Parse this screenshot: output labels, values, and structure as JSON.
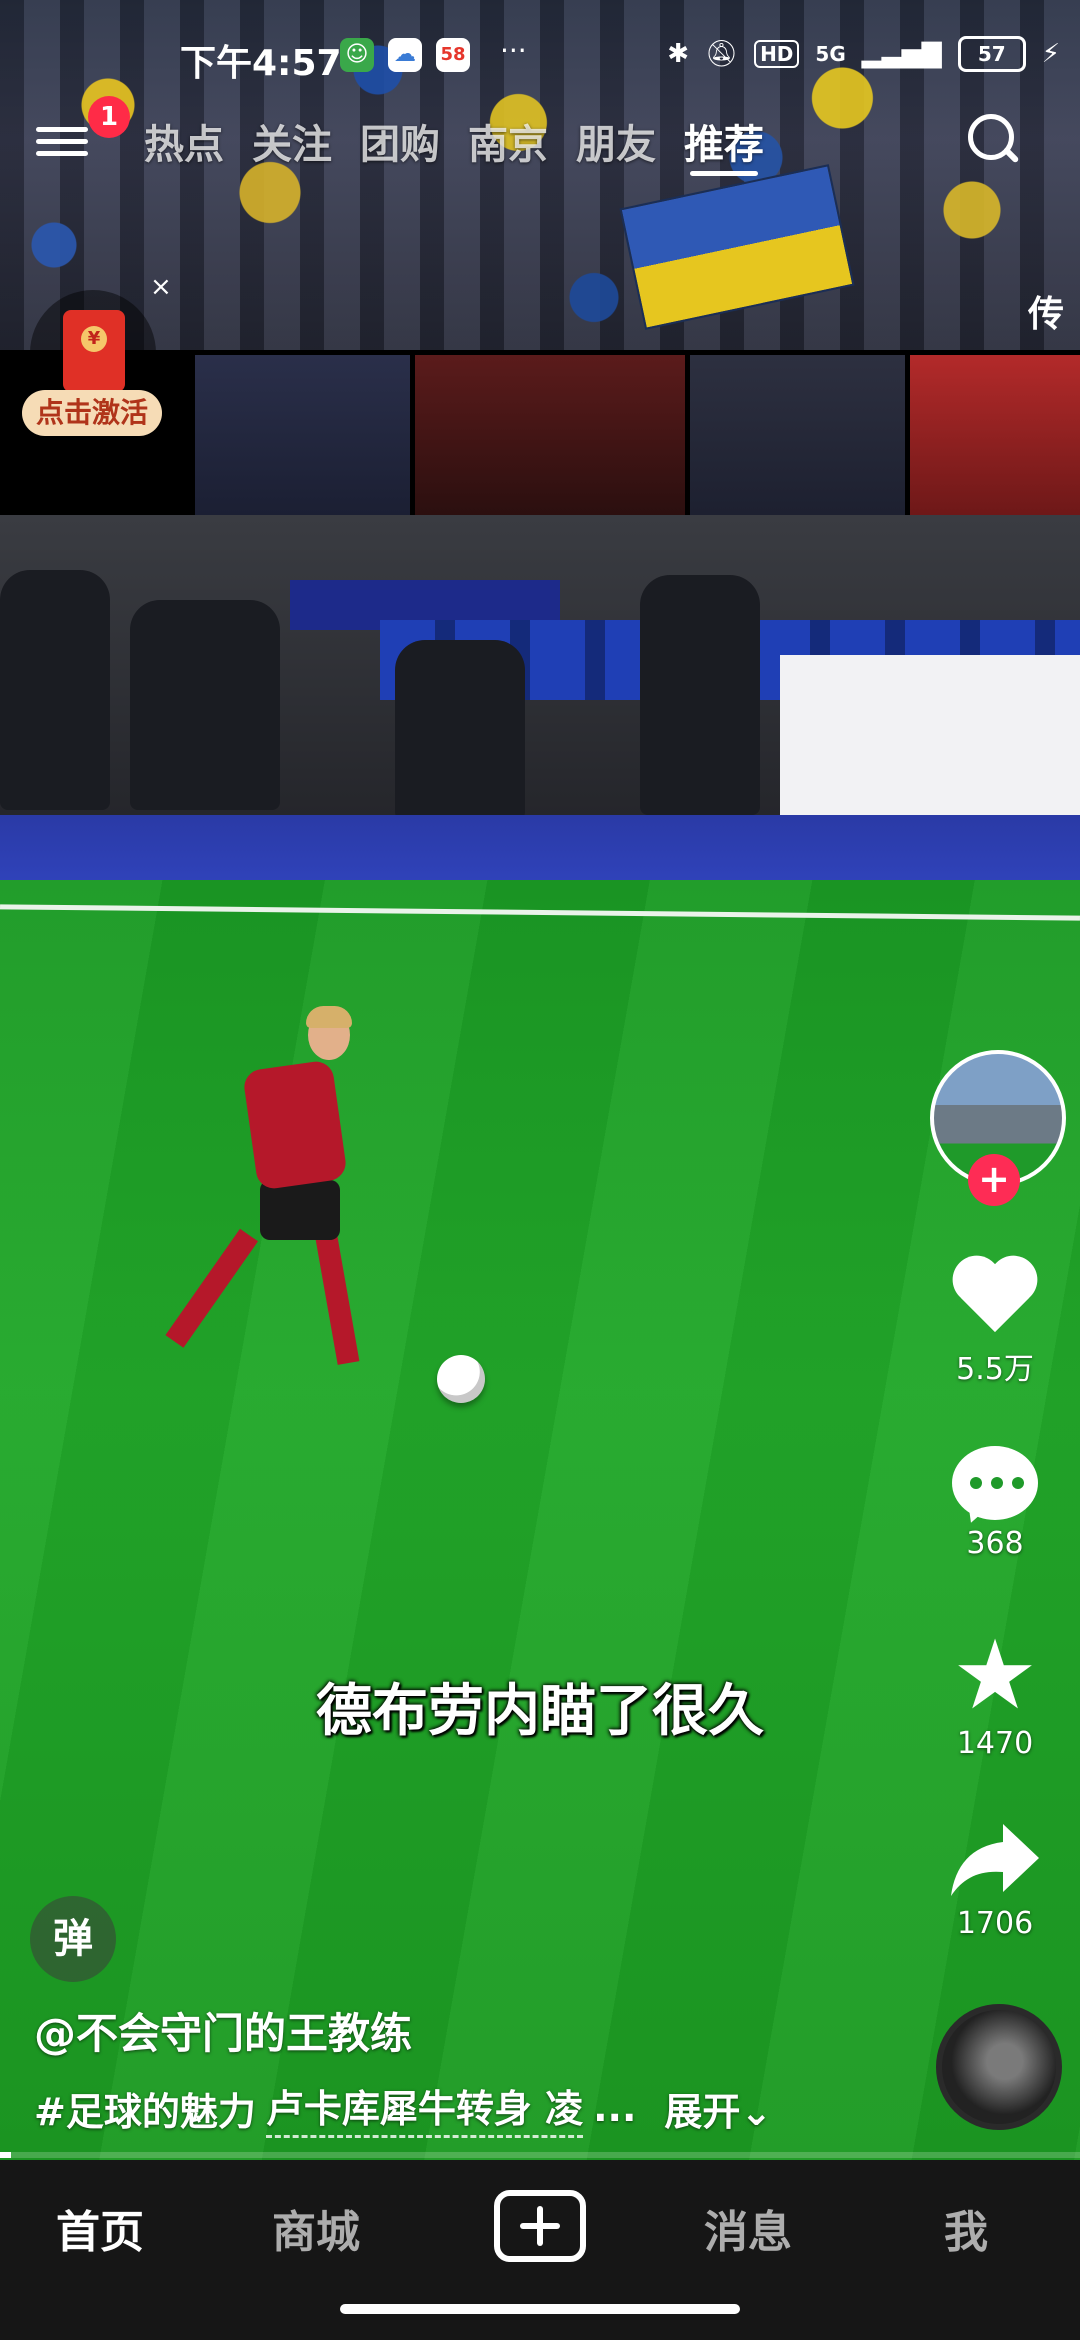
{
  "status_bar": {
    "time": "下午4:57",
    "app_icon_3_label": "58",
    "more": "···",
    "network": "5G",
    "hd": "HD",
    "battery_level": 57,
    "battery_text": "57"
  },
  "top_nav": {
    "notification_count": "1",
    "tabs": [
      "热点",
      "关注",
      "团购",
      "南京",
      "朋友",
      "推荐"
    ],
    "active_tab": "推荐",
    "right_peek": "传"
  },
  "red_packet": {
    "label": "点击激活",
    "coin": "¥",
    "close": "×"
  },
  "video": {
    "subtitle": "德布劳内瞄了很久",
    "author": "@不会守门的王教练",
    "hashtag": "#足球的魅力",
    "desc_link": "卢卡库犀牛转身 凌",
    "ellipsis": "...",
    "expand": "展开",
    "expand_icon": "chevron-down-icon",
    "danmu": "弹",
    "progress": 0.01
  },
  "actions": {
    "follow": "+",
    "likes": "5.5万",
    "comments": "368",
    "favorites": "1470",
    "shares": "1706"
  },
  "bottom_nav": {
    "items": [
      "首页",
      "商城",
      "消息",
      "我"
    ],
    "active": "首页"
  },
  "colors": {
    "accent": "#fe2c55",
    "badge": "#ff2b47",
    "pitch": "#1f9f27"
  }
}
